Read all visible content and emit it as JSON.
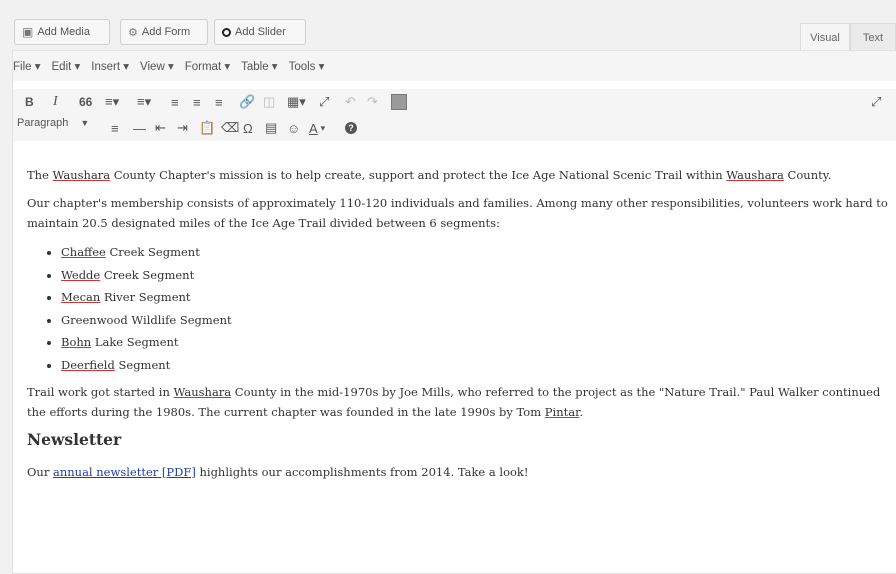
{
  "media_buttons": {
    "add_media": "Add Media",
    "add_form": "Add Form",
    "add_slider": "Add Slider"
  },
  "tabs": {
    "visual": "Visual",
    "text": "Text"
  },
  "menu": [
    "File ▾",
    "Edit ▾",
    "Insert ▾",
    "View ▾",
    "Format ▾",
    "Table ▾",
    "Tools ▾"
  ],
  "toolbar": {
    "bold": "B",
    "italic": "I",
    "blockquote": "66",
    "format_select": "Paragraph",
    "special_char": "Ω",
    "help": "?"
  },
  "content": {
    "p1_a": "The ",
    "p1_b": "Waushara",
    "p1_c": " County Chapter's mission is to help create, support and protect the Ice Age National Scenic Trail within ",
    "p1_d": "Waushara",
    "p1_e": " County.",
    "p2": "Our chapter's membership consists of approximately 110-120 individuals and families. Among many other responsibilities, volunteers work hard to maintain 20.5 designated miles of the Ice Age Trail divided between 6 segments:",
    "segments": [
      {
        "name": "Chaffee",
        "rest": " Creek Segment"
      },
      {
        "name": "Wedde",
        "rest": " Creek Segment"
      },
      {
        "name": "Mecan",
        "rest": " River Segment"
      },
      {
        "name": "",
        "rest": "Greenwood Wildlife Segment"
      },
      {
        "name": "Bohn",
        "rest": " Lake Segment"
      },
      {
        "name": "Deerfield",
        "rest": " Segment"
      }
    ],
    "p3_a": "Trail work got started in ",
    "p3_b": "Waushara",
    "p3_c": " County in the mid-1970s by Joe Mills, who referred to the project as the \"Nature Trail.\" Paul Walker continued the efforts during the 1980s. The current chapter was founded in the late 1990s by Tom ",
    "p3_d": "Pintar",
    "p3_e": ".",
    "heading": "Newsletter",
    "p4_a": "Our ",
    "p4_link": "annual newsletter [PDF]",
    "p4_c": " highlights our accomplishments from 2014. Take a look!"
  }
}
